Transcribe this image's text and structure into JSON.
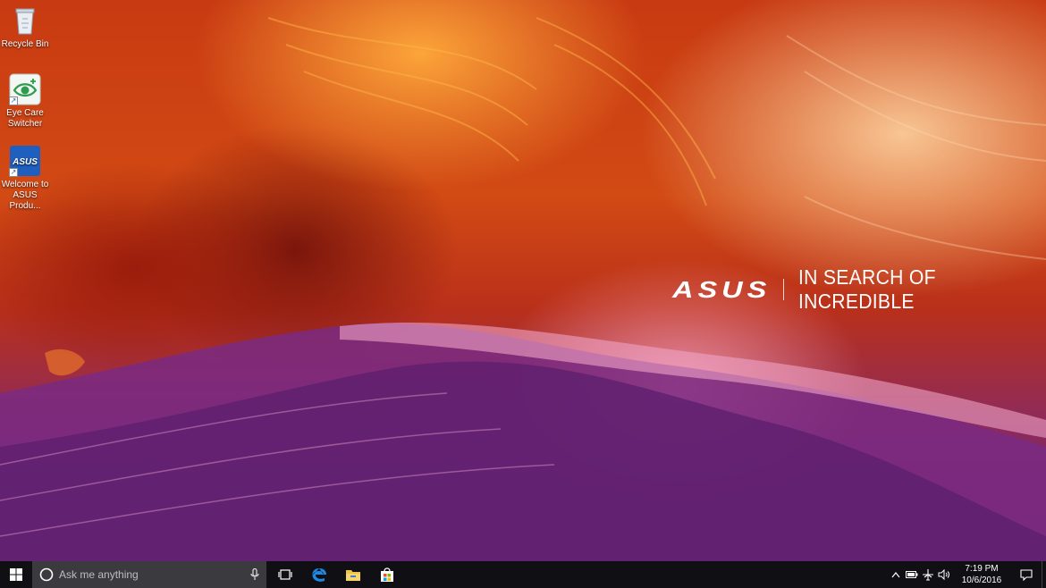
{
  "desktop": {
    "icons": [
      {
        "label_line1": "Recycle Bin",
        "label_line2": "",
        "icon": "recycle-bin-icon"
      },
      {
        "label_line1": "Eye Care",
        "label_line2": "Switcher",
        "icon": "eye-care-icon"
      },
      {
        "label_line1": "Welcome to",
        "label_line2": "ASUS Produ...",
        "icon": "asus-icon"
      }
    ],
    "asus_logo_text": "ASUS",
    "tagline": "IN SEARCH OF INCREDIBLE"
  },
  "taskbar": {
    "search_placeholder": "Ask me anything",
    "apps": [
      "task-view-icon",
      "edge-icon",
      "file-explorer-icon",
      "store-icon"
    ],
    "clock": {
      "time": "7:19 PM",
      "date": "10/6/2016"
    },
    "accent": "#1e88e5"
  }
}
